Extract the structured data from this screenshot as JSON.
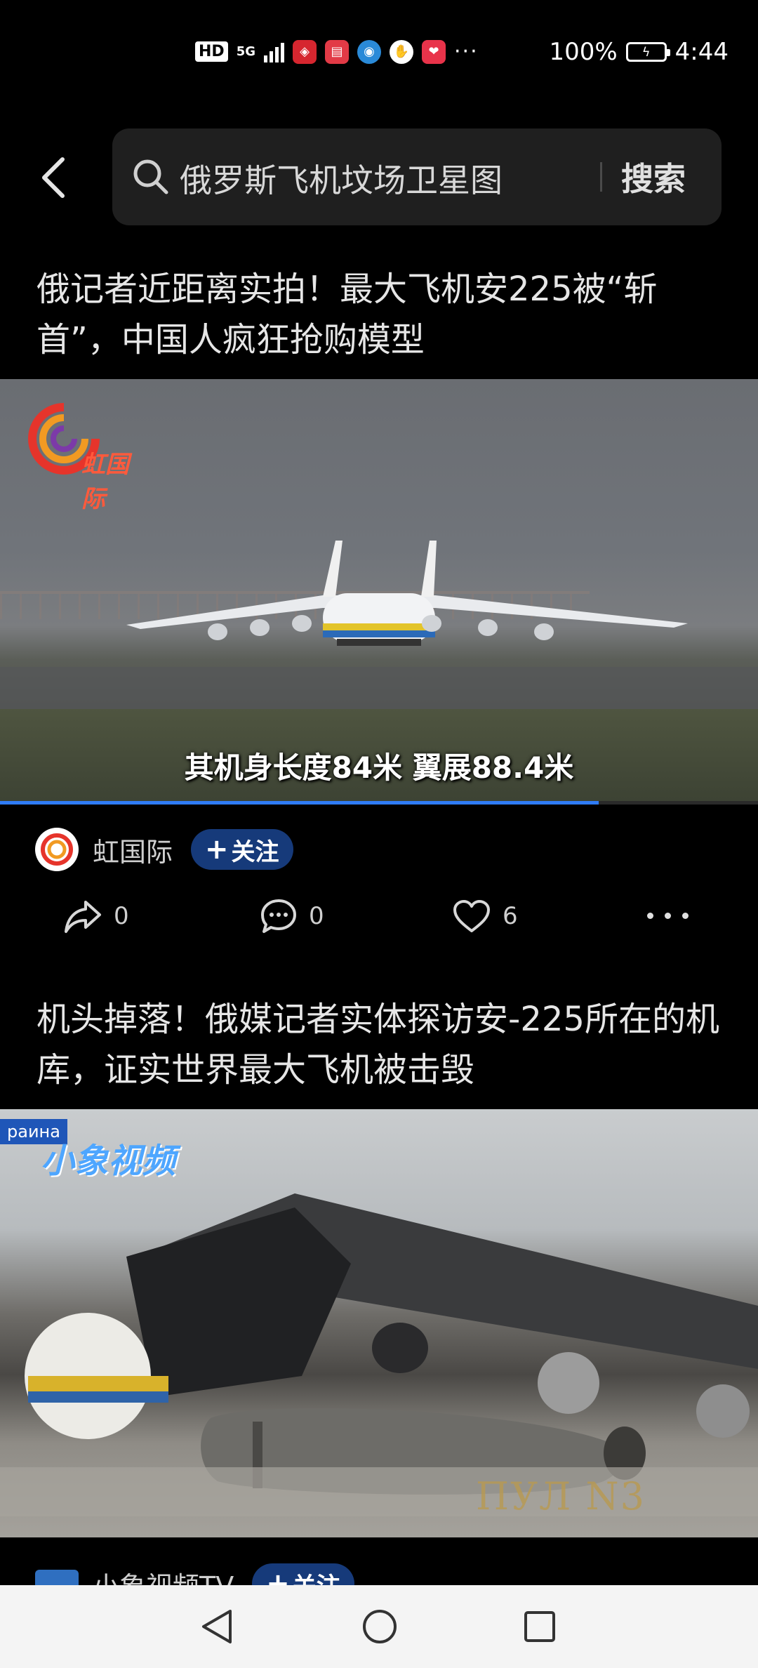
{
  "status_bar": {
    "hd": "HD",
    "network": "5G",
    "battery": "100%",
    "time": "4:44",
    "more": "···"
  },
  "search": {
    "query": "俄罗斯飞机坟场卫星图",
    "button": "搜索"
  },
  "articles": [
    {
      "title": "俄记者近距离实拍！最大飞机安225被“斩首”，中国人疯狂抢购模型",
      "video": {
        "logo_text": "虹国际",
        "caption": "其机身长度84米 翼展88.4米",
        "progress": 0.79
      },
      "author": "虹国际",
      "follow_label": "关注",
      "follow_plus": "+",
      "shares": "0",
      "comments": "0",
      "likes": "6"
    },
    {
      "title": "机头掉落！俄媒记者实体探访安-225所在的机库，证实世界最大飞机被击毁",
      "video": {
        "tag": "раина",
        "logo_text": "小象视频",
        "watermark": "ПУЛ N3"
      },
      "author": "小象视频TV",
      "follow_label": "关注",
      "follow_plus": "+"
    }
  ],
  "colors": {
    "background": "#000000",
    "follow_button": "#163a7a",
    "progress": "#2f7cf6",
    "nav_bar": "#f4f4f4"
  }
}
